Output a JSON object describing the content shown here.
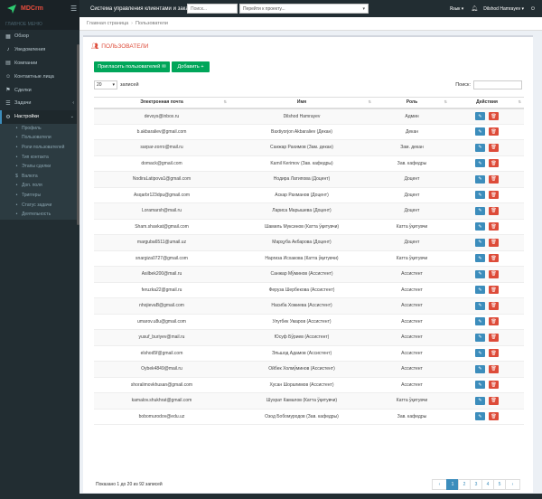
{
  "header": {
    "logo_text": "MDCrm",
    "app_title": "Система управления клиентами и заказами",
    "search_placeholder": "Поиск...",
    "project_select": "Перейти к проекту...",
    "language": "Язык",
    "user": "Dilshod Hamrayev"
  },
  "sidebar": {
    "header": "ГЛАВНОЕ МЕНЮ",
    "items": [
      {
        "label": "Обзор",
        "icon": "dashboard-icon"
      },
      {
        "label": "Уведомления",
        "icon": "bell-icon"
      },
      {
        "label": "Компании",
        "icon": "building-icon"
      },
      {
        "label": "Контактные лица",
        "icon": "contacts-icon"
      },
      {
        "label": "Сделки",
        "icon": "handshake-icon"
      },
      {
        "label": "Задачи",
        "icon": "tasks-icon"
      },
      {
        "label": "Настройки",
        "icon": "gear-icon"
      }
    ],
    "subitems": [
      {
        "label": "Профиль",
        "icon": "user-icon"
      },
      {
        "label": "Пользователи",
        "icon": "users-icon"
      },
      {
        "label": "Роли пользователей",
        "icon": "roles-icon"
      },
      {
        "label": "Тип контакта",
        "icon": "contact-type-icon"
      },
      {
        "label": "Этапы сделки",
        "icon": "stages-icon"
      },
      {
        "label": "Валюта",
        "icon": "currency-icon"
      },
      {
        "label": "Доп. поля",
        "icon": "fields-icon"
      },
      {
        "label": "Триггеры",
        "icon": "trigger-icon"
      },
      {
        "label": "Статус задачи",
        "icon": "status-icon"
      },
      {
        "label": "Деятельность",
        "icon": "activity-icon"
      }
    ]
  },
  "breadcrumb": {
    "home": "Главная страница",
    "current": "Пользователи"
  },
  "page": {
    "title": "ПОЛЬЗОВАТЕЛИ",
    "invite_label": "Пригласить пользователей",
    "add_label": "Добавить",
    "length_value": "20",
    "length_suffix": "записей",
    "search_label": "Поиск:",
    "info": "Показано 1 до 20 из 92 записей"
  },
  "table": {
    "columns": [
      "Электронная почта",
      "Имя",
      "Роль",
      "Действия"
    ],
    "rows": [
      [
        "devsys@inbox.ru",
        "Dilshod Hamrayev",
        "Админ"
      ],
      [
        "b.akbaraliev@gmail.com",
        "Baxtiyorjon Akbaraliev (Декан)",
        "Декан"
      ],
      [
        "sarpar-zorro@mail.ru",
        "Санжар Рахимов (Зам. декан)",
        "Зам. декан"
      ],
      [
        "domack@gmail.com",
        "Kamil Kerimov (Зав. кафедры)",
        "Зав. кафедры"
      ],
      [
        "NodiraLatipova1@gmail.com",
        "Нодира Латипова (Доцент)",
        "Доцент"
      ],
      [
        "Asqarbr123dpu@gmail.com",
        "Аскар Рахманов (Доцент)",
        "Доцент"
      ],
      [
        "Loramarsh@mail.ru",
        "Лариса Марышева (Доцент)",
        "Доцент"
      ],
      [
        "Sham.shavkat@gmail.com",
        "Шамиль Муксинов (Катта ўқитувчи)",
        "Катта ўқитувчи"
      ],
      [
        "marguba6511@umail.uz",
        "Марҳуба Акбарова (Доцент)",
        "Доцент"
      ],
      [
        "snargiza0727@gmail.com",
        "Наргиза Исхакова (Катта ўқитувчи)",
        "Катта ўқитувчи"
      ],
      [
        "Asilbek200@mail.ru",
        "Санжар Мўминов (Ассистент)",
        "Ассистент"
      ],
      [
        "feruzka22@gmail.ru",
        "Феруза Шербекова (Ассистент)",
        "Ассистент"
      ],
      [
        "nhojievaB@gmail.com",
        "Насиба Хожиева (Ассистент)",
        "Ассистент"
      ],
      [
        "umarov.u8u@gmail.com",
        "Улугбек Умаров (Ассистент)",
        "Ассистент"
      ],
      [
        "yusuf_buriyev@mail.ru",
        "Юсуф Бўриев (Ассистент)",
        "Ассистент"
      ],
      [
        "elshod5f@gmail.com",
        "Эльшод Адамов (Ассистент)",
        "Ассистент"
      ],
      [
        "Oybek4849@mail.ru",
        "Ойбек Холмўминов (Ассистент)",
        "Ассистент"
      ],
      [
        "shoralimovkhusan@gmail.com",
        "Хусан Шоралимов (Ассистент)",
        "Ассистент"
      ],
      [
        "kamalov.shukhrat@gmail.com",
        "Шухрат Камалов (Катта ўқитувчи)",
        "Катта ўқитувчи"
      ],
      [
        "bobomurodov@edu.uz",
        "Озод Бобомуродов (Зав. кафедры)",
        "Зав. кафедры"
      ]
    ]
  },
  "pagination": {
    "prev": "‹",
    "pages": [
      "1",
      "2",
      "3",
      "4",
      "5"
    ],
    "next": "›"
  },
  "colors": {
    "accent": "#3c8dbc",
    "success": "#00a65a",
    "danger": "#dd4b39",
    "sidebar": "#222d32"
  }
}
